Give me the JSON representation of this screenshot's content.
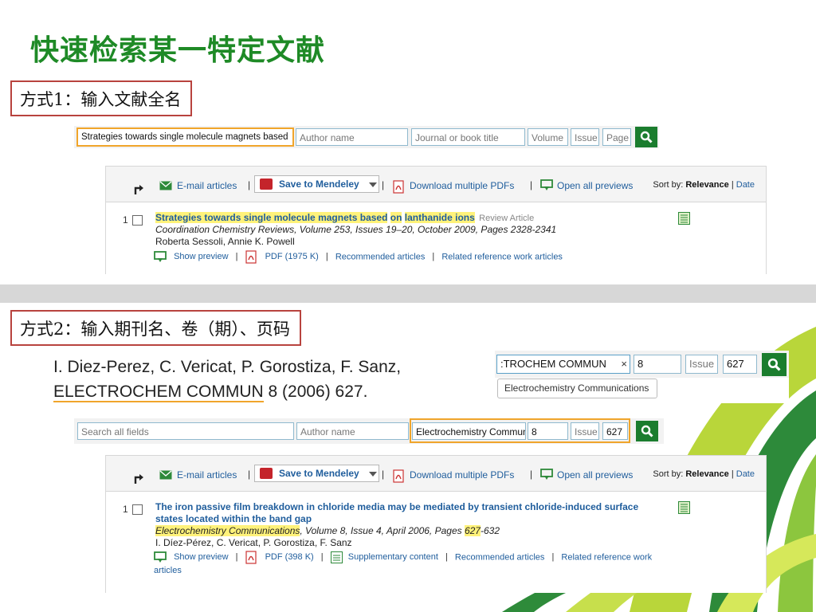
{
  "slide": {
    "title": "快速检索某一特定文献",
    "method1": "方式1：输入文献全名",
    "method2": "方式2：输入期刊名、卷（期）、页码",
    "reference": {
      "line1": "I. Diez-Perez, C. Vericat, P. Gorostiza, F. Sanz,",
      "journal_abbr": "ELECTROCHEM COMMUN",
      "rest": " 8 (2006) 627."
    }
  },
  "search1": {
    "title_value": "Strategies towards single molecule magnets based",
    "author_placeholder": "Author name",
    "journal_placeholder": "Journal or book title",
    "volume_placeholder": "Volume",
    "issue_placeholder": "Issue",
    "page_placeholder": "Page"
  },
  "toolbar": {
    "email": "E-mail articles",
    "mendeley": "Save to Mendeley",
    "pdfs": "Download multiple PDFs",
    "previews": "Open all previews",
    "sort_label": "Sort by: ",
    "sort_relevance": "Relevance",
    "sort_sep": " | ",
    "sort_date": "Date",
    "sep": "|"
  },
  "result1": {
    "number": "1",
    "title_part1": "Strategies towards single molecule magnets based",
    "title_part2": "on",
    "title_part3": "lanthanide ions",
    "type": "Review Article",
    "citation": "Coordination Chemistry Reviews, Volume 253, Issues 19–20, October 2009, Pages 2328-2341",
    "authors": "Roberta Sessoli, Annie K. Powell",
    "show_preview": "Show preview",
    "pdf": "PDF (1975 K)",
    "recommended": "Recommended articles",
    "related": "Related reference work articles",
    "sep": "|"
  },
  "inset": {
    "journal_value": ":TROCHEM COMMUN",
    "clear": "×",
    "volume_value": "8",
    "issue_placeholder": "Issue",
    "page_value": "627",
    "suggestion": "Electrochemistry Communications"
  },
  "search2": {
    "all_fields_placeholder": "Search all fields",
    "author_placeholder": "Author name",
    "journal_value": "Electrochemistry Commun",
    "volume_value": "8",
    "issue_placeholder": "Issue",
    "page_value": "627"
  },
  "result2": {
    "number": "1",
    "title": "The iron passive film breakdown in chloride media may be mediated by transient chloride-induced surface states located within the band gap",
    "journal": "Electrochemistry Communications",
    "cit_mid": ", Volume 8, Issue 4, April 2006, Pages ",
    "page_start": "627",
    "page_end": "-632",
    "authors": "I. Díez-Pérez, C. Vericat, P. Gorostiza, F. Sanz",
    "show_preview": "Show preview",
    "pdf": "PDF (398 K)",
    "supplementary": "Supplementary content",
    "recommended": "Recommended articles",
    "related": "Related reference work articles",
    "sep": "|"
  },
  "colors": {
    "title_green": "#1e8a26",
    "method_border": "#b8433e",
    "highlight_orange": "#f0a52b",
    "link_blue": "#1f5d9c",
    "search_button": "#1b7d2e",
    "highlight_yellow": "#fff27a"
  }
}
